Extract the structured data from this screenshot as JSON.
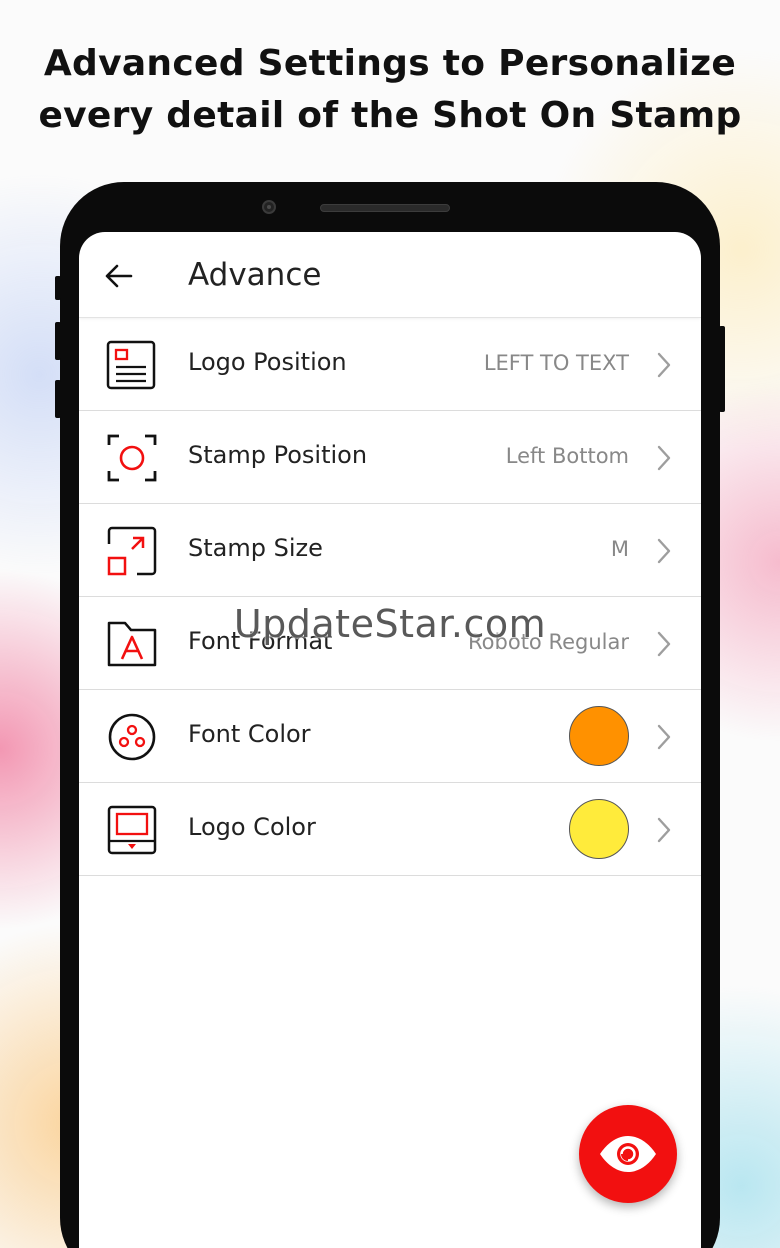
{
  "headline": {
    "line1": "Advanced Settings to Personalize",
    "line2": "every detail of the Shot On Stamp"
  },
  "appbar": {
    "back_icon": "arrow-left-icon",
    "title": "Advance"
  },
  "settings": [
    {
      "label": "Logo Position",
      "value": "LEFT TO TEXT",
      "icon": "logo-position-icon"
    },
    {
      "label": "Stamp Position",
      "value": "Left Bottom",
      "icon": "stamp-position-icon"
    },
    {
      "label": "Stamp Size",
      "value": "M",
      "icon": "stamp-size-icon"
    },
    {
      "label": "Font Format",
      "value": "Roboto Regular",
      "icon": "font-format-icon"
    },
    {
      "label": "Font Color",
      "color": "#ff9100",
      "icon": "font-color-icon"
    },
    {
      "label": "Logo Color",
      "color": "#ffeb3b",
      "icon": "logo-color-icon"
    }
  ],
  "watermark": "UpdateStar.com",
  "fab": {
    "icon": "eye-icon",
    "color": "#f21010"
  },
  "colors": {
    "accent": "#f21010",
    "text": "#222222",
    "value_text": "#888888"
  }
}
